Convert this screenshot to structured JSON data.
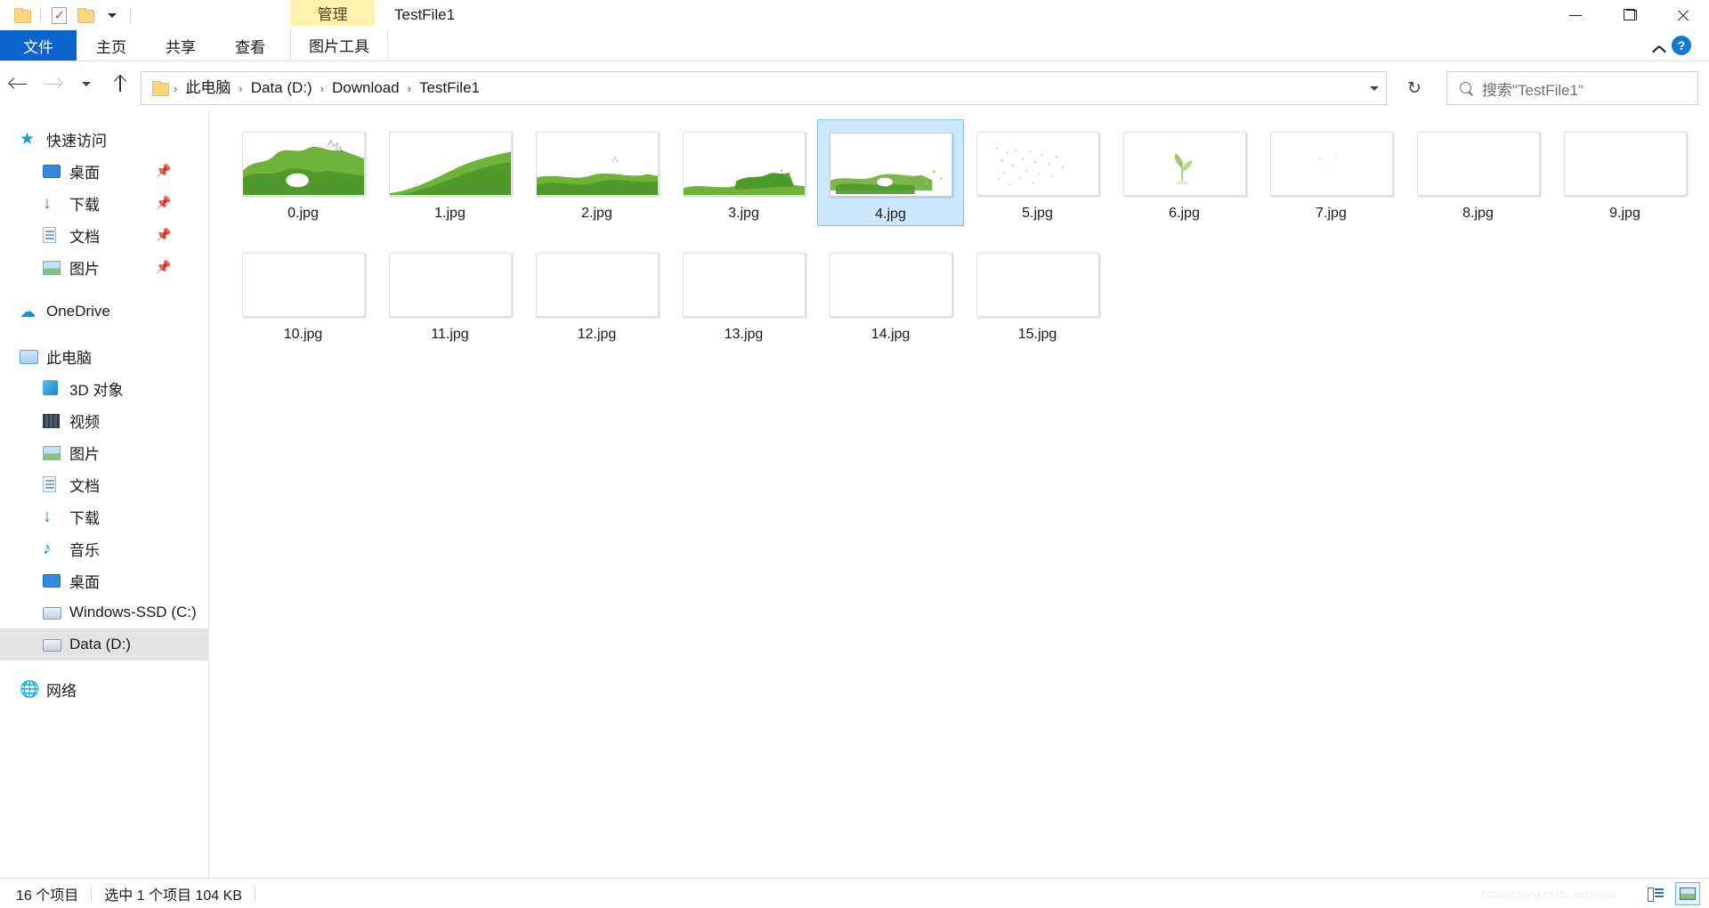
{
  "window": {
    "title": "TestFile1",
    "contextual_tab_header": "管理",
    "quick_access": [
      {
        "name": "folder-icon",
        "label": "新建文件夹"
      },
      {
        "name": "properties-icon",
        "label": "属性"
      },
      {
        "name": "folder-icon-2",
        "label": "文件夹"
      },
      {
        "name": "chevron-down-icon",
        "label": "自定义快速访问工具栏"
      }
    ],
    "controls": {
      "minimize": "最小化",
      "maximize": "最大化",
      "close": "关闭"
    }
  },
  "ribbon": {
    "tabs": [
      {
        "label": "文件",
        "active": true
      },
      {
        "label": "主页",
        "active": false
      },
      {
        "label": "共享",
        "active": false
      },
      {
        "label": "查看",
        "active": false
      }
    ],
    "contextual_tab": {
      "label": "图片工具"
    },
    "collapse_label": "折叠功能区",
    "help_label": "?"
  },
  "address": {
    "back_label": "后退",
    "forward_label": "前进",
    "history_label": "最近浏览的位置",
    "up_label": "上移到上一层",
    "breadcrumbs": [
      "此电脑",
      "Data (D:)",
      "Download",
      "TestFile1"
    ],
    "separator": "›",
    "dropdown_label": "以前的位置",
    "refresh_label": "刷新",
    "refresh_glyph": "↻"
  },
  "search": {
    "placeholder": "搜索\"TestFile1\"",
    "icon": "search-icon"
  },
  "sidebar": {
    "groups": [
      {
        "header": {
          "label": "快速访问",
          "icon": "star-icon"
        },
        "items": [
          {
            "label": "桌面",
            "icon": "desktop-icon",
            "pinned": true
          },
          {
            "label": "下载",
            "icon": "download-icon",
            "pinned": true
          },
          {
            "label": "文档",
            "icon": "documents-icon",
            "pinned": true
          },
          {
            "label": "图片",
            "icon": "pictures-icon",
            "pinned": true
          }
        ]
      },
      {
        "header": {
          "label": "OneDrive",
          "icon": "cloud-icon"
        },
        "items": []
      },
      {
        "header": {
          "label": "此电脑",
          "icon": "pc-icon"
        },
        "items": [
          {
            "label": "3D 对象",
            "icon": "3d-objects-icon",
            "pinned": false
          },
          {
            "label": "视频",
            "icon": "videos-icon",
            "pinned": false
          },
          {
            "label": "图片",
            "icon": "pictures-icon",
            "pinned": false
          },
          {
            "label": "文档",
            "icon": "documents-icon",
            "pinned": false
          },
          {
            "label": "下载",
            "icon": "download-icon",
            "pinned": false
          },
          {
            "label": "音乐",
            "icon": "music-icon",
            "pinned": false
          },
          {
            "label": "桌面",
            "icon": "desktop-icon",
            "pinned": false
          },
          {
            "label": "Windows-SSD (C:)",
            "icon": "drive-icon",
            "pinned": false
          },
          {
            "label": "Data (D:)",
            "icon": "drive-icon",
            "pinned": false,
            "selected": true
          }
        ]
      },
      {
        "header": {
          "label": "网络",
          "icon": "network-icon"
        },
        "items": []
      }
    ]
  },
  "files": [
    {
      "name": "0.jpg",
      "selected": false,
      "thumb": "grass-heavy"
    },
    {
      "name": "1.jpg",
      "selected": false,
      "thumb": "grass-slope"
    },
    {
      "name": "2.jpg",
      "selected": false,
      "thumb": "grass-band"
    },
    {
      "name": "3.jpg",
      "selected": false,
      "thumb": "grass-low"
    },
    {
      "name": "4.jpg",
      "selected": true,
      "thumb": "grass-sparse"
    },
    {
      "name": "5.jpg",
      "selected": false,
      "thumb": "speckle"
    },
    {
      "name": "6.jpg",
      "selected": false,
      "thumb": "sprout"
    },
    {
      "name": "7.jpg",
      "selected": false,
      "thumb": "faint"
    },
    {
      "name": "8.jpg",
      "selected": false,
      "thumb": "blank"
    },
    {
      "name": "9.jpg",
      "selected": false,
      "thumb": "blank"
    },
    {
      "name": "10.jpg",
      "selected": false,
      "thumb": "blank"
    },
    {
      "name": "11.jpg",
      "selected": false,
      "thumb": "blank"
    },
    {
      "name": "12.jpg",
      "selected": false,
      "thumb": "blank"
    },
    {
      "name": "13.jpg",
      "selected": false,
      "thumb": "blank"
    },
    {
      "name": "14.jpg",
      "selected": false,
      "thumb": "blank"
    },
    {
      "name": "15.jpg",
      "selected": false,
      "thumb": "blank"
    }
  ],
  "status": {
    "item_count": "16 个项目",
    "selection": "选中 1 个项目  104 KB",
    "views": [
      {
        "name": "details-view",
        "label": "详细信息",
        "active": false
      },
      {
        "name": "large-icons-view",
        "label": "大图标",
        "active": true
      }
    ]
  },
  "watermark": "https://blog.csdn.net/mou",
  "colors": {
    "accent": "#0b63ce",
    "selection_fill": "#cce8ff",
    "selection_border": "#7fbdea",
    "contextual_tab": "#fdf2ae",
    "sidebar_selected": "#e3e3e3"
  }
}
